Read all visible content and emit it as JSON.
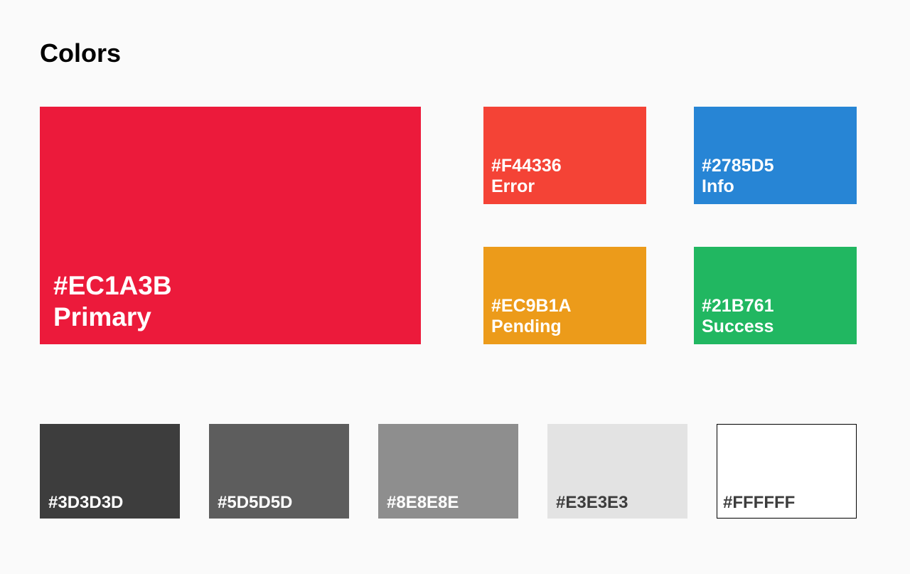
{
  "page_title": "Colors",
  "primary": {
    "hex": "#EC1A3B",
    "name": "Primary",
    "text_color": "#FFFFFF"
  },
  "status": {
    "error": {
      "hex": "#F44336",
      "name": "Error",
      "text_color": "#FFFFFF"
    },
    "info": {
      "hex": "#2785D5",
      "name": "Info",
      "text_color": "#FFFFFF"
    },
    "pending": {
      "hex": "#EC9B1A",
      "name": "Pending",
      "text_color": "#FFFFFF"
    },
    "success": {
      "hex": "#21B761",
      "name": "Success",
      "text_color": "#FFFFFF"
    }
  },
  "grays": [
    {
      "hex": "#3D3D3D",
      "text_color": "#FFFFFF"
    },
    {
      "hex": "#5D5D5D",
      "text_color": "#FFFFFF"
    },
    {
      "hex": "#8E8E8E",
      "text_color": "#FFFFFF"
    },
    {
      "hex": "#E3E3E3",
      "text_color": "#3D3D3D"
    },
    {
      "hex": "#FFFFFF",
      "text_color": "#3D3D3D"
    }
  ]
}
